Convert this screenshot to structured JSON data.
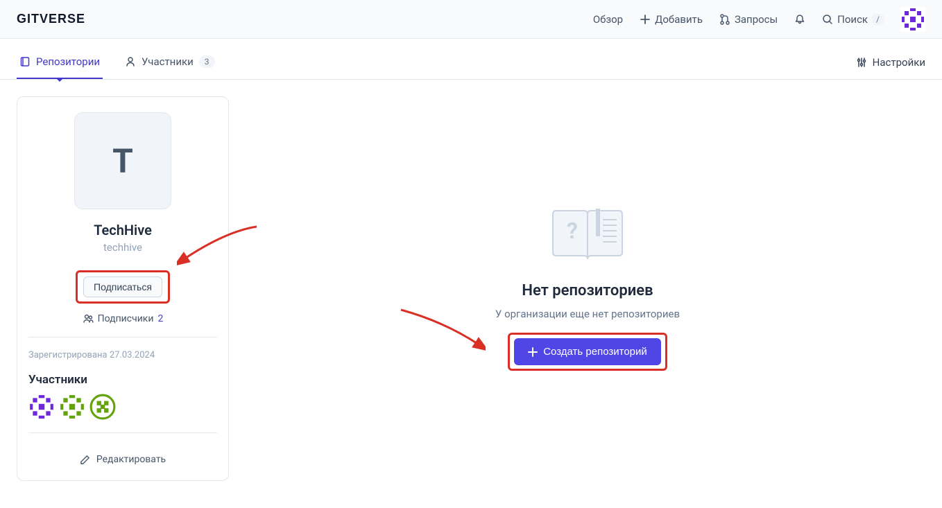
{
  "header": {
    "logo": "GITVERSE",
    "nav": {
      "overview": "Обзор",
      "add": "Добавить",
      "requests": "Запросы",
      "search": "Поиск",
      "search_kbd": "/"
    }
  },
  "tabs": {
    "repositories": "Репозитории",
    "members": "Участники",
    "members_count": "3",
    "settings": "Настройки"
  },
  "org": {
    "avatar_letter": "T",
    "name": "TechHive",
    "handle": "techhive",
    "subscribe": "Подписаться",
    "followers_label": "Подписчики",
    "followers_count": "2",
    "registered": "Зарегистрирована 27.03.2024",
    "members_title": "Участники",
    "edit": "Редактировать"
  },
  "empty": {
    "title": "Нет репозиториев",
    "subtitle": "У организации еще нет репозиториев",
    "create": "Создать репозиторий"
  }
}
